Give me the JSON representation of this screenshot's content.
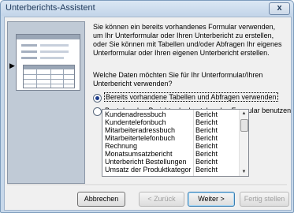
{
  "window": {
    "title": "Unterberichts-Assistent",
    "close_label": "x"
  },
  "intro_text": "Sie können ein bereits vorhandenes Formular verwenden, um Ihr Unterformular oder Ihren Unterbericht zu erstellen, oder Sie können mit Tabellen und/oder Abfragen Ihr eigenes Unterformular oder Ihren eigenen Unterbericht erstellen.",
  "question": "Welche Daten möchten Sie für Ihr Unterformular/Ihren Unterbericht verwenden?",
  "options": [
    {
      "label": "Bereits vorhandene Tabellen und Abfragen verwenden",
      "selected": true
    },
    {
      "label": "Bestehenden Bericht oder bestehendes Formular benutzen",
      "selected": false
    }
  ],
  "list": [
    {
      "name": "Kundenadressbuch",
      "type": "Bericht"
    },
    {
      "name": "Kundentelefonbuch",
      "type": "Bericht"
    },
    {
      "name": "Mitarbeiteradressbuch",
      "type": "Bericht"
    },
    {
      "name": "Mitarbeitertelefonbuch",
      "type": "Bericht"
    },
    {
      "name": "Rechnung",
      "type": "Bericht"
    },
    {
      "name": "Monatsumsatzbericht",
      "type": "Bericht"
    },
    {
      "name": "Unterbericht Bestellungen",
      "type": "Bericht"
    },
    {
      "name": "Umsatz der Produktkategorie",
      "type": "Bericht"
    }
  ],
  "buttons": {
    "cancel": "Abbrechen",
    "back": "< Zurück",
    "next": "Weiter >",
    "finish": "Fertig stellen"
  }
}
